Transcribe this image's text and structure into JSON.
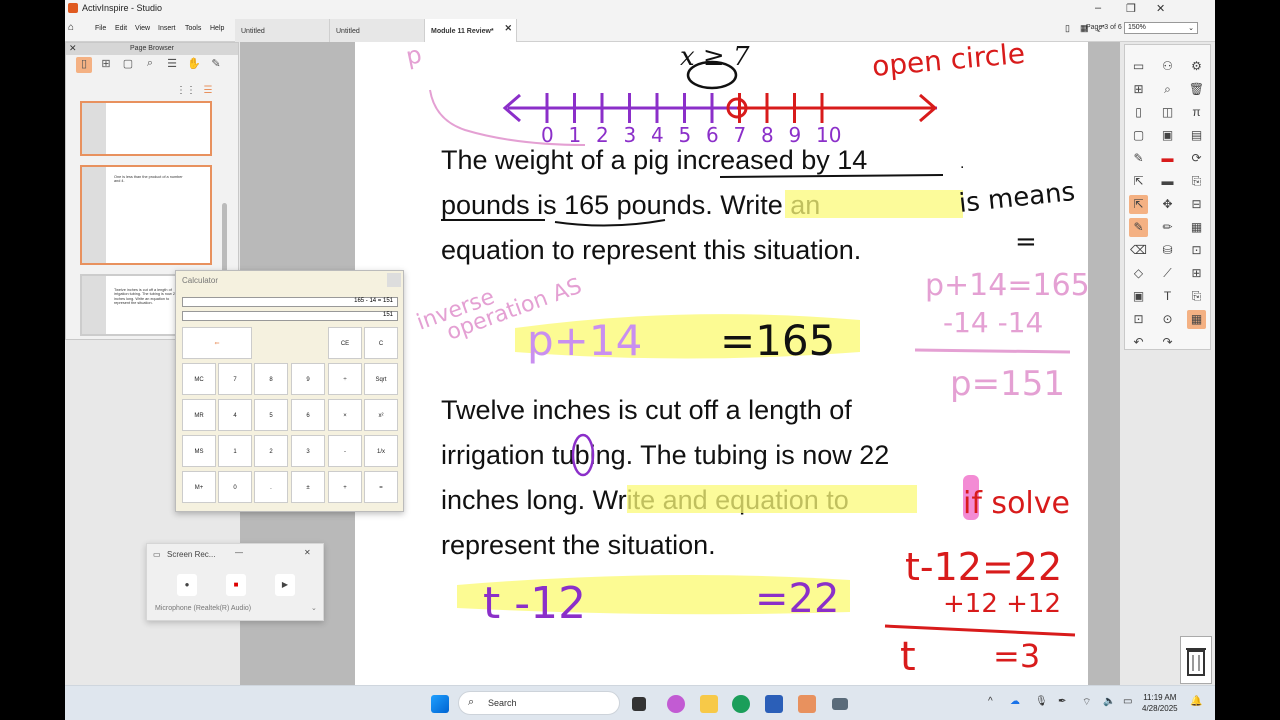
{
  "window": {
    "title": "ActivInspire - Studio"
  },
  "menu": [
    "File",
    "Edit",
    "View",
    "Insert",
    "Tools",
    "Help"
  ],
  "tabs": [
    {
      "label": "Untitled",
      "active": false
    },
    {
      "label": "Untitled",
      "active": false
    },
    {
      "label": "Module 11 Review*",
      "active": true
    }
  ],
  "page_indicator": "Page 3 of 6",
  "zoom": "150%",
  "page_browser": {
    "title": "Page Browser",
    "thumb2_text": "One is less than the product of a number and 4.",
    "thumb3_text": "Twelve inches is cut off a length of irrigation tubing. The tubing is now 22 inches long. Write an equation to represent the situation."
  },
  "flipchart": {
    "inequality": "x ≥ 7",
    "number_line_labels": [
      "0",
      "1",
      "2",
      "3",
      "4",
      "5",
      "6",
      "7",
      "8",
      "9",
      "10"
    ],
    "problem1": [
      "The weight of a pig increased by 14",
      "pounds is 165 pounds. Write an",
      "equation to represent this situation."
    ],
    "problem2": [
      "Twelve inches is cut off a length of",
      "irrigation tubing. The tubing is now 22",
      "inches long. Write and equation to",
      "represent the situation."
    ],
    "handwriting": {
      "open_circle": "open circle",
      "is_means": "is means",
      "equals": "=",
      "inverse": "inverse",
      "operation": "operation AS",
      "p14": "p+14",
      "eq165": "=165",
      "work1": "p+14=165",
      "work2": "-14 -14",
      "work3": "p=151",
      "if_solve": "if solve",
      "t12": "t -12",
      "eq22": "=22",
      "work4": "t-12=22",
      "work5": "+12 +12",
      "work6": "t",
      "work7": "=3"
    }
  },
  "calculator": {
    "title": "Calculator",
    "expression": "165 - 14 = 151",
    "result": "151",
    "keys": [
      [
        "MC",
        "7",
        "8",
        "9",
        "÷",
        "Sqrt"
      ],
      [
        "MR",
        "4",
        "5",
        "6",
        "×",
        "x²"
      ],
      [
        "MS",
        "1",
        "2",
        "3",
        "-",
        "1/x"
      ],
      [
        "M+",
        "0",
        ".",
        "±",
        "+",
        "="
      ]
    ],
    "ce": "CE",
    "c": "C",
    "back": "⇐"
  },
  "screen_recorder": {
    "title": "Screen Rec...",
    "microphone": "Microphone (Realtek(R) Audio)"
  },
  "taskbar": {
    "search": "Search",
    "time": "11:19 AM",
    "date": "4/28/2025"
  },
  "colors": {
    "accent": "#e8915e",
    "highlight": "#fbfa78",
    "pen_purple": "#8b2fc9",
    "pen_red": "#d81b1b",
    "pen_pink": "#e4a0d3"
  }
}
